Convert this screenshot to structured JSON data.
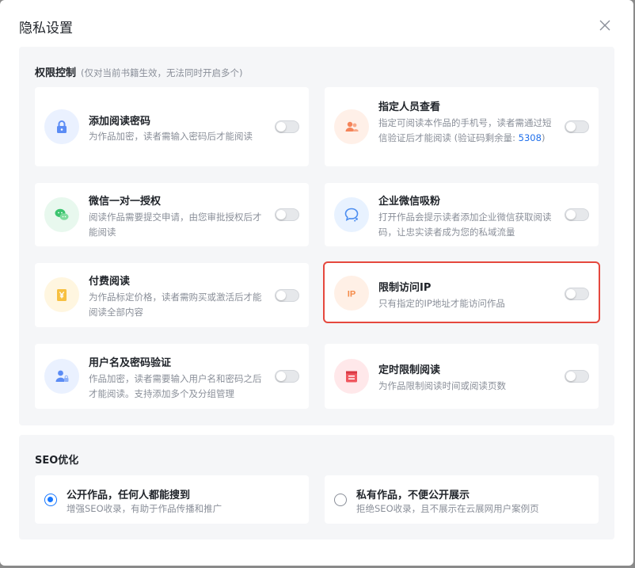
{
  "dialog": {
    "title": "隐私设置",
    "close_icon": "close-icon"
  },
  "permission": {
    "heading": "权限控制",
    "hint": "(仅对当前书籍生效，无法同时开启多个)",
    "cards": [
      {
        "title": "添加阅读密码",
        "desc": "为作品加密，读者需输入密码后才能阅读",
        "icon": "lock-icon",
        "enabled": false
      },
      {
        "title": "指定人员查看",
        "desc": "指定可阅读本作品的手机号，读者需通过短信验证后才能阅读 (验证码剩余量: ",
        "desc_link": "5308",
        "desc_tail": ")",
        "icon": "users-icon",
        "enabled": false
      },
      {
        "title": "微信一对一授权",
        "desc": "阅读作品需要提交申请，由您审批授权后才能阅读",
        "icon": "wechat-icon",
        "enabled": false
      },
      {
        "title": "企业微信吸粉",
        "desc": "打开作品会提示读者添加企业微信获取阅读码，让忠实读者成为您的私域流量",
        "icon": "chat-bubble-icon",
        "enabled": false
      },
      {
        "title": "付费阅读",
        "desc": "为作品标定价格，读者需购买或激活后才能阅读全部内容",
        "icon": "yen-icon",
        "enabled": false
      },
      {
        "title": "限制访问IP",
        "desc": "只有指定的IP地址才能访问作品",
        "icon": "ip-icon",
        "enabled": false,
        "selected": true
      },
      {
        "title": "用户名及密码验证",
        "desc": "作品加密，读者需要输入用户名和密码之后才能阅读。支持添加多个及分组管理",
        "icon": "user-lock-icon",
        "enabled": false
      },
      {
        "title": "定时限制阅读",
        "desc": "为作品限制阅读时间或阅读页数",
        "icon": "calendar-icon",
        "enabled": false
      }
    ]
  },
  "seo": {
    "heading": "SEO优化",
    "options": [
      {
        "title": "公开作品，任何人都能搜到",
        "desc": "增强SEO收录，有助于作品传播和推广",
        "checked": true
      },
      {
        "title": "私有作品，不便公开展示",
        "desc": "拒绝SEO收录，且不展示在云展网用户案例页",
        "checked": false
      }
    ]
  },
  "colors": {
    "accent": "#1677ff",
    "selected_border": "#e5483e",
    "link": "#1f6feb"
  }
}
